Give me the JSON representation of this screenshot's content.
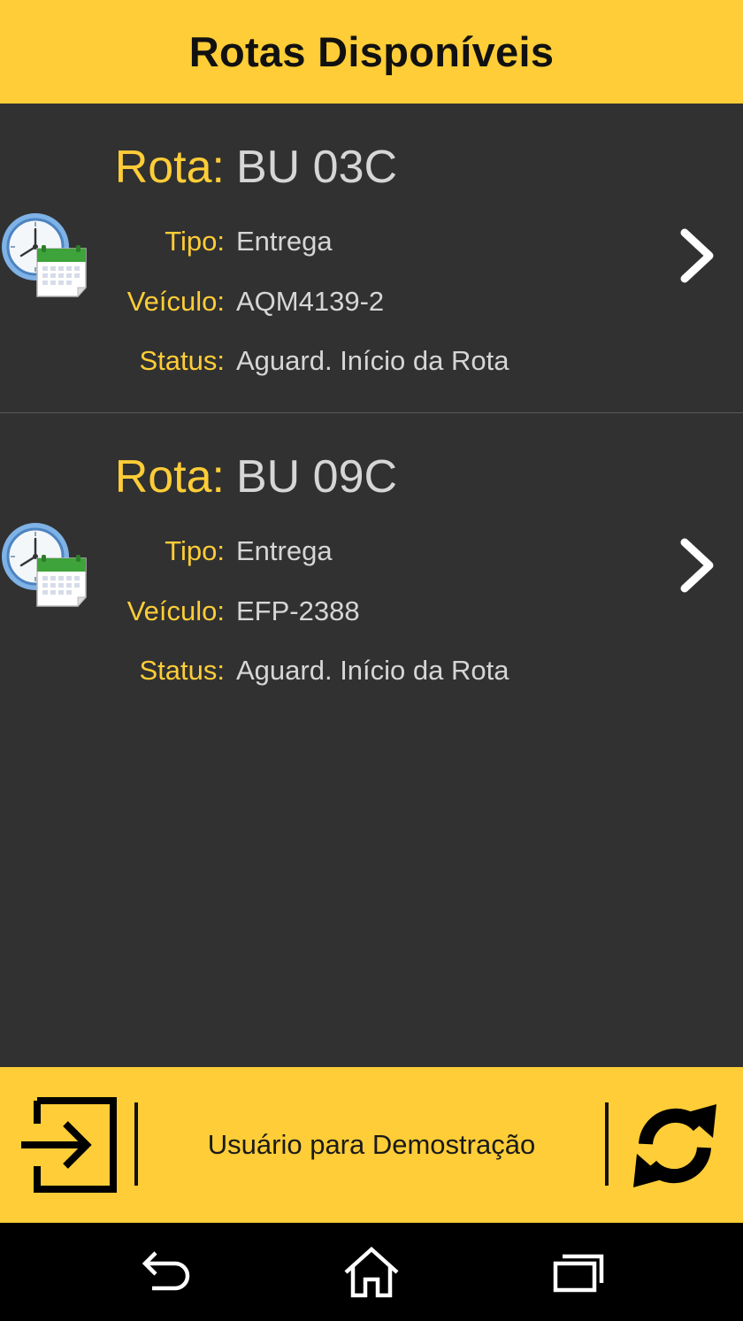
{
  "header": {
    "title": "Rotas Disponíveis"
  },
  "labels": {
    "rota": "Rota:",
    "tipo": "Tipo:",
    "veiculo": "Veículo:",
    "status": "Status:"
  },
  "routes": [
    {
      "code": "BU 03C",
      "tipo": "Entrega",
      "veiculo": "AQM4139-2",
      "status": "Aguard. Início da Rota"
    },
    {
      "code": "BU 09C",
      "tipo": "Entrega",
      "veiculo": "EFP-2388",
      "status": "Aguard. Início da Rota"
    }
  ],
  "footer": {
    "user_label": "Usuário para Demostração"
  },
  "icons": {
    "route_icon": "clock-calendar-icon",
    "chevron": "chevron-right-icon",
    "logout": "logout-icon",
    "refresh": "refresh-icon",
    "nav_back": "back-icon",
    "nav_home": "home-icon",
    "nav_recents": "recents-icon"
  },
  "colors": {
    "accent": "#fecd37",
    "background": "#313131",
    "value_text": "#d6d6d6",
    "navbar": "#000000"
  }
}
